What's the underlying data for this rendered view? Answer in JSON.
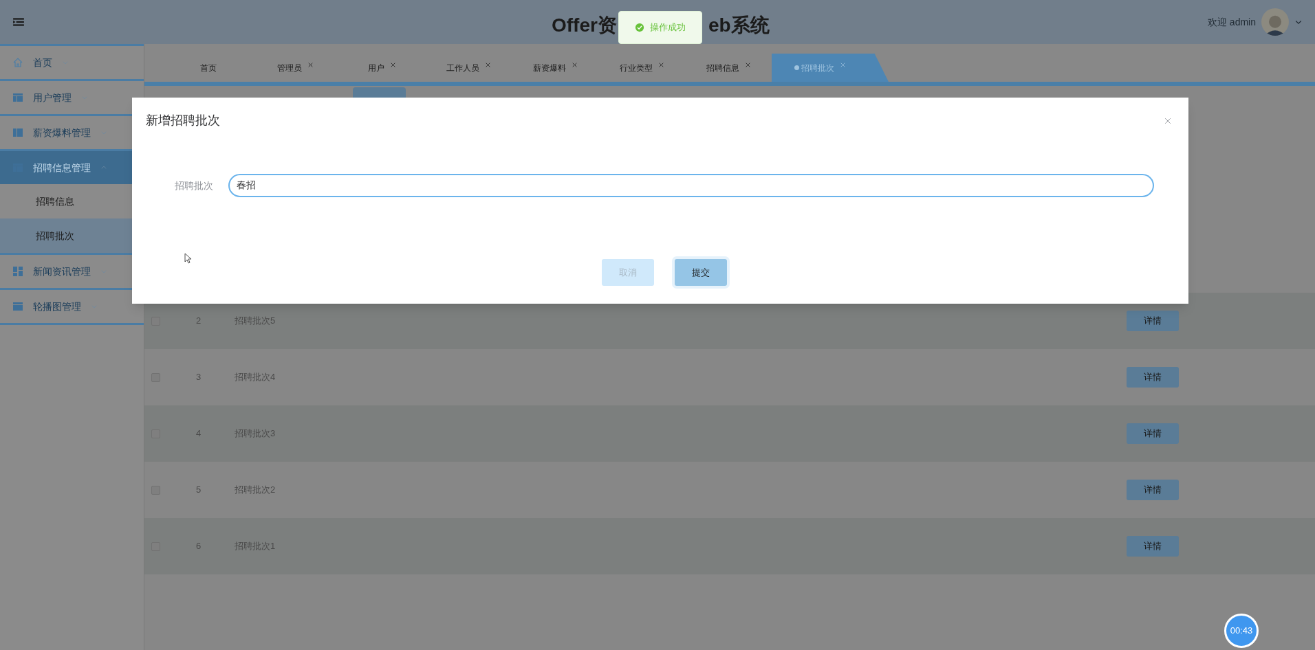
{
  "header": {
    "title_left": "Offer资",
    "title_right": "eb系统",
    "greeting": "欢迎 admin"
  },
  "toast": {
    "message": "操作成功"
  },
  "sidebar": {
    "items": [
      {
        "label": "首页",
        "kind": "home",
        "expanded": false,
        "selected": false
      },
      {
        "label": "用户管理",
        "kind": "table",
        "expanded": false,
        "selected": false
      },
      {
        "label": "薪资爆料管理",
        "kind": "columns",
        "expanded": false,
        "selected": false
      },
      {
        "label": "招聘信息管理",
        "kind": "table",
        "expanded": true,
        "selected": true,
        "children": [
          {
            "label": "招聘信息",
            "selected": false
          },
          {
            "label": "招聘批次",
            "selected": true
          }
        ]
      },
      {
        "label": "新闻资讯管理",
        "kind": "grid",
        "expanded": false,
        "selected": false
      },
      {
        "label": "轮播图管理",
        "kind": "card",
        "expanded": false,
        "selected": false
      }
    ]
  },
  "tabs": [
    {
      "label": "首页",
      "closable": false,
      "selected": false
    },
    {
      "label": "管理员",
      "closable": true,
      "selected": false
    },
    {
      "label": "用户",
      "closable": true,
      "selected": false
    },
    {
      "label": "工作人员",
      "closable": true,
      "selected": false
    },
    {
      "label": "薪资爆料",
      "closable": true,
      "selected": false
    },
    {
      "label": "行业类型",
      "closable": true,
      "selected": false
    },
    {
      "label": "招聘信息",
      "closable": true,
      "selected": false
    },
    {
      "label": "招聘批次",
      "closable": true,
      "selected": true
    }
  ],
  "table": {
    "rows": [
      {
        "checked": false,
        "index": "2",
        "name": "招聘批次5",
        "action": "详情"
      },
      {
        "checked": false,
        "index": "3",
        "name": "招聘批次4",
        "action": "详情"
      },
      {
        "checked": false,
        "index": "4",
        "name": "招聘批次3",
        "action": "详情"
      },
      {
        "checked": false,
        "index": "5",
        "name": "招聘批次2",
        "action": "详情"
      },
      {
        "checked": false,
        "index": "6",
        "name": "招聘批次1",
        "action": "详情"
      }
    ]
  },
  "modal": {
    "title": "新增招聘批次",
    "field_label": "招聘批次",
    "field_value": "春招",
    "buttons": [
      {
        "label": "取消",
        "kind": "secondary",
        "disabled": true
      },
      {
        "label": "提交",
        "kind": "primary",
        "disabled": false
      }
    ]
  },
  "timer": {
    "text": "00:43"
  }
}
